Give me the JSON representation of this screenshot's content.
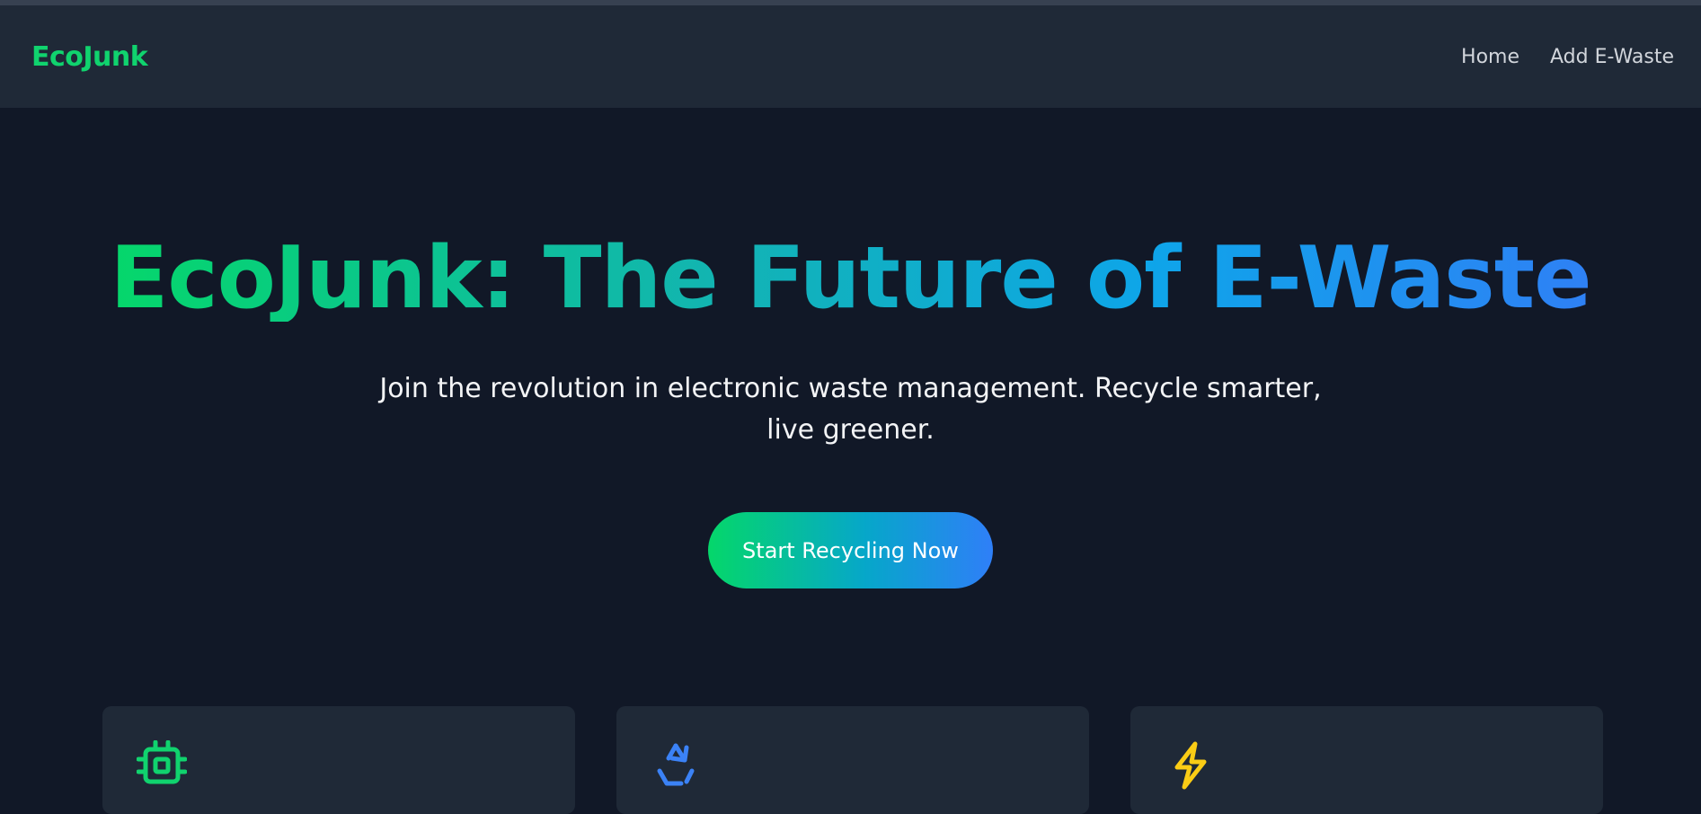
{
  "header": {
    "brand": "EcoJunk",
    "nav": [
      {
        "label": "Home"
      },
      {
        "label": "Add E-Waste"
      }
    ]
  },
  "hero": {
    "title": "EcoJunk: The Future of E-Waste",
    "subtitle": "Join the revolution in electronic waste management. Recycle smarter, live greener.",
    "cta_label": "Start Recycling Now"
  },
  "cards": [
    {
      "icon": "chip-icon",
      "icon_color": "#10d36e"
    },
    {
      "icon": "recycle-icon",
      "icon_color": "#3b82f6"
    },
    {
      "icon": "lightning-icon",
      "icon_color": "#facc15"
    }
  ],
  "colors": {
    "background": "#111827",
    "navbar": "#1f2937",
    "brand_green": "#10d36e",
    "accent_blue": "#2f80f5"
  }
}
